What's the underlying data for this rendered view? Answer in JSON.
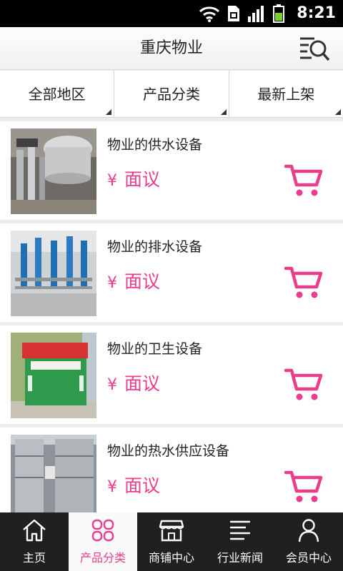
{
  "status_bar": {
    "time": "8:21",
    "icons": [
      "wifi-icon",
      "sim-icon",
      "signal-icon",
      "battery-icon"
    ]
  },
  "header": {
    "title": "重庆物业",
    "action_icon": "search-list-icon"
  },
  "filters": [
    {
      "label": "全部地区"
    },
    {
      "label": "产品分类"
    },
    {
      "label": "最新上架"
    }
  ],
  "products": [
    {
      "title": "物业的供水设备",
      "currency": "¥",
      "price": "面议",
      "image": "stainless-water-tank-pumps"
    },
    {
      "title": "物业的排水设备",
      "currency": "¥",
      "price": "面议",
      "image": "blue-drainage-pumps"
    },
    {
      "title": "物业的卫生设备",
      "currency": "¥",
      "price": "面议",
      "image": "green-sanitation-bin"
    },
    {
      "title": "物业的热水供应设备",
      "currency": "¥",
      "price": "面议",
      "image": "stainless-hot-water-tanks"
    }
  ],
  "bottom_nav": [
    {
      "label": "主页",
      "icon": "home-icon",
      "active": false
    },
    {
      "label": "产品分类",
      "icon": "category-grid-icon",
      "active": true
    },
    {
      "label": "商铺中心",
      "icon": "shop-icon",
      "active": false
    },
    {
      "label": "行业新闻",
      "icon": "news-icon",
      "active": false
    },
    {
      "label": "会员中心",
      "icon": "member-icon",
      "active": false
    }
  ],
  "colors": {
    "accent": "#e93e8a",
    "nav_bg": "#202020",
    "status_bar": "#000000",
    "battery": "#7ccf2a"
  }
}
